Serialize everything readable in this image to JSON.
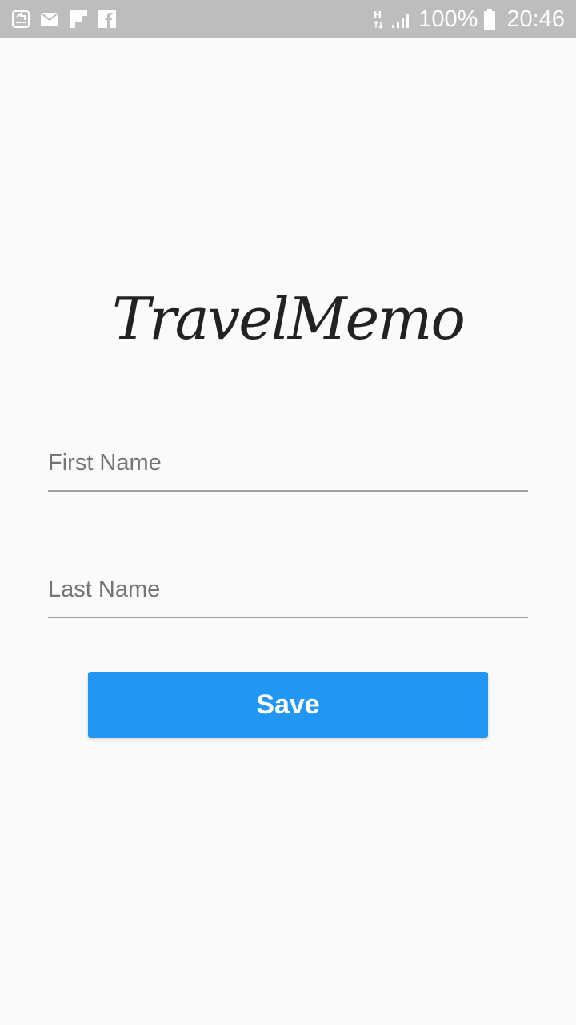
{
  "status_bar": {
    "notification_icons": [
      "screenshot-icon",
      "mail-icon",
      "flipboard-icon",
      "facebook-icon"
    ],
    "network_type": "H",
    "battery_percent": "100%",
    "time": "20:46"
  },
  "app": {
    "title": "TravelMemo"
  },
  "form": {
    "first_name_placeholder": "First Name",
    "first_name_value": "",
    "last_name_placeholder": "Last Name",
    "last_name_value": "",
    "save_label": "Save"
  },
  "colors": {
    "status_bar_bg": "#bdbdbd",
    "background": "#fafafa",
    "accent": "#2196f3",
    "underline": "#9e9e9e"
  }
}
